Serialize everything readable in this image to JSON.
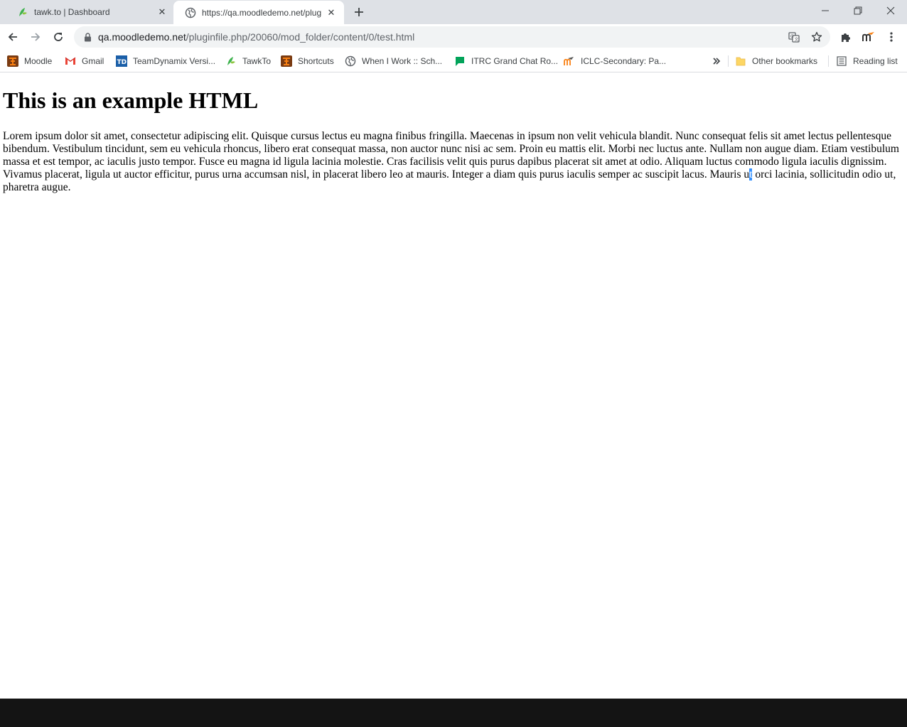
{
  "tabs": [
    {
      "title": "tawk.to | Dashboard",
      "active": false
    },
    {
      "title": "https://qa.moodledemo.net/plug",
      "active": true
    }
  ],
  "toolbar": {
    "url_host": "qa.moodledemo.net",
    "url_path": "/pluginfile.php/20060/mod_folder/content/0/test.html"
  },
  "bookmarks": [
    {
      "label": "Moodle",
      "icon": "moodle-icon"
    },
    {
      "label": "Gmail",
      "icon": "gmail-icon"
    },
    {
      "label": "TeamDynamix Versi...",
      "icon": "teamdynamix-icon"
    },
    {
      "label": "TawkTo",
      "icon": "tawkto-icon"
    },
    {
      "label": "Shortcuts",
      "icon": "moodle-icon"
    },
    {
      "label": "When I Work :: Sch...",
      "icon": "globe-icon"
    },
    {
      "label": "ITRC Grand Chat Ro...",
      "icon": "chat-icon"
    },
    {
      "label": "ICLC-Secondary: Pa...",
      "icon": "moodle-m-icon"
    }
  ],
  "bookmarks_right": {
    "other": "Other bookmarks",
    "reading": "Reading list"
  },
  "page": {
    "heading": "This is an example HTML",
    "paragraph_before": "Lorem ipsum dolor sit amet, consectetur adipiscing elit. Quisque cursus lectus eu magna finibus fringilla. Maecenas in ipsum non velit vehicula blandit. Nunc consequat felis sit amet lectus pellentesque bibendum. Vestibulum tincidunt, sem eu vehicula rhoncus, libero erat consequat massa, non auctor nunc nisi ac sem. Proin eu mattis elit. Morbi nec luctus ante. Nullam non augue diam. Etiam vestibulum massa et est tempor, ac iaculis justo tempor. Fusce eu magna id ligula lacinia molestie. Cras facilisis velit quis purus dapibus placerat sit amet at odio. Aliquam luctus commodo ligula iaculis dignissim. Vivamus placerat, ligula ut auctor efficitur, purus urna accumsan nisl, in placerat libero leo at mauris. Integer a diam quis purus iaculis semper ac suscipit lacus. Mauris u",
    "paragraph_selected": "t",
    "paragraph_after": " orci lacinia, sollicitudin odio ut, pharetra augue."
  },
  "colors": {
    "tabstrip_bg": "#dee1e6",
    "omnibox_bg": "#f1f3f4",
    "selection": "#3390ff",
    "moodle_orange": "#f98012"
  }
}
